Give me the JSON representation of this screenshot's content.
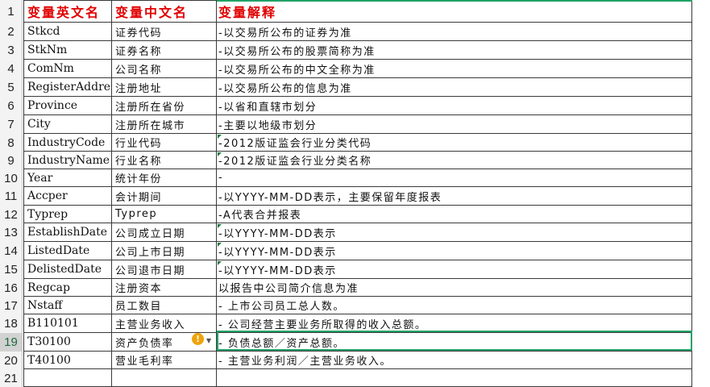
{
  "header": {
    "row_num": "1",
    "col_name": "变量英文名",
    "col_cn": "变量中文名",
    "col_desc": "变量解释"
  },
  "rows": [
    {
      "num": "2",
      "name": "Stkcd",
      "cn": "证券代码",
      "desc": "-以交易所公布的证券为准"
    },
    {
      "num": "3",
      "name": "StkNm",
      "cn": "证券名称",
      "desc": "-以交易所公布的股票简称为准"
    },
    {
      "num": "4",
      "name": "ComNm",
      "cn": "公司名称",
      "desc": "-以交易所公布的中文全称为准"
    },
    {
      "num": "5",
      "name": "RegisterAddress",
      "cn": "注册地址",
      "desc": "-以交易所公布的信息为准"
    },
    {
      "num": "6",
      "name": "Province",
      "cn": "注册所在省份",
      "desc": "-以省和直辖市划分"
    },
    {
      "num": "7",
      "name": "City",
      "cn": "注册所在城市",
      "desc": "-主要以地级市划分"
    },
    {
      "num": "8",
      "name": "IndustryCode",
      "cn": "行业代码",
      "desc": "-2012版证监会行业分类代码"
    },
    {
      "num": "9",
      "name": "IndustryName",
      "cn": "行业名称",
      "desc": "-2012版证监会行业分类名称"
    },
    {
      "num": "10",
      "name": "Year",
      "cn": "统计年份",
      "desc": "-"
    },
    {
      "num": "11",
      "name": "Accper",
      "cn": "会计期间",
      "desc": " -以YYYY-MM-DD表示，主要保留年度报表"
    },
    {
      "num": "12",
      "name": "Typrep",
      "cn": "Typrep",
      "desc": "-A代表合并报表"
    },
    {
      "num": "13",
      "name": "EstablishDate",
      "cn": "公司成立日期",
      "desc": " -以YYYY-MM-DD表示"
    },
    {
      "num": "14",
      "name": "ListedDate",
      "cn": "公司上市日期",
      "desc": " -以YYYY-MM-DD表示"
    },
    {
      "num": "15",
      "name": "DelistedDate",
      "cn": "公司退市日期",
      "desc": " -以YYYY-MM-DD表示"
    },
    {
      "num": "16",
      "name": "Regcap",
      "cn": "注册资本",
      "desc": "以报告中公司简介信息为准"
    },
    {
      "num": "17",
      "name": "Nstaff",
      "cn": "员工数目",
      "desc": " - 上市公司员工总人数。"
    },
    {
      "num": "18",
      "name": "B110101",
      "cn": "主营业务收入",
      "desc": " - 公司经营主要业务所取得的收入总额。"
    },
    {
      "num": "19",
      "name": "T30100",
      "cn": "资产负债率",
      "desc": " - 负债总额／资产总额。"
    },
    {
      "num": "20",
      "name": "T40100",
      "cn": "营业毛利率",
      "desc": " - 主营业务利润／主营业务收入。"
    },
    {
      "num": "21",
      "name": "",
      "cn": "",
      "desc": ""
    }
  ]
}
